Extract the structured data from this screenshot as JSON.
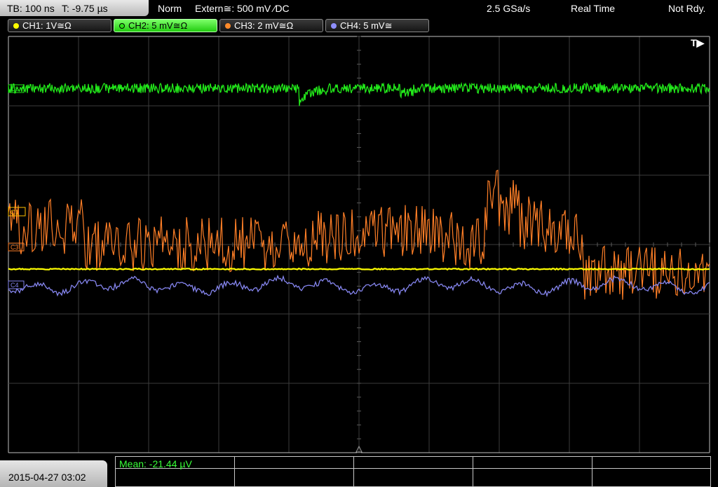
{
  "status": {
    "timebase": "TB: 100 ns",
    "trigger_time": "T: -9.75 µs",
    "acq_mode": "Norm",
    "trigger_source": "Extern≅: 500 mV ⁄DC",
    "sample_rate": "2.5 GSa/s",
    "time_mode": "Real Time",
    "ready_state": "Not Rdy."
  },
  "channels": [
    {
      "label": "CH1: 1V≅Ω",
      "color": "#ffff00",
      "active": false
    },
    {
      "label": "CH2: 5 mV≅Ω",
      "color": "#2ee01a",
      "active": true
    },
    {
      "label": "CH3: 2 mV≅Ω",
      "color": "#ff8a2a",
      "active": false
    },
    {
      "label": "CH4: 5 mV≅",
      "color": "#8f8fff",
      "active": false
    }
  ],
  "markers": {
    "ch2": "C2",
    "ch1": "C1",
    "ch3": "C3",
    "ch4": "C4",
    "trigger": "T▶"
  },
  "trace_colors": {
    "ch1": "#ffff00",
    "ch2": "#22e81a",
    "ch3": "#ff7f27",
    "ch4": "#8585ee"
  },
  "date": "2015-04-27 03:02",
  "measurement": "Mean: -21.44 µV"
}
